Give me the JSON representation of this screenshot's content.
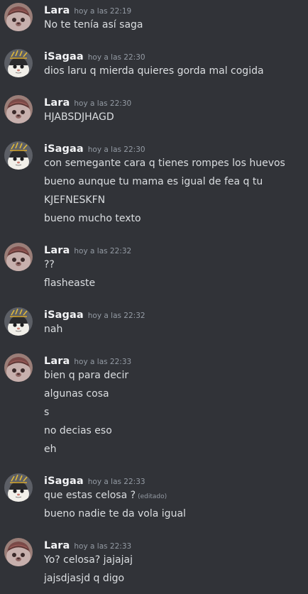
{
  "colors": {
    "background": "#313338",
    "username": "#f2f3f5",
    "timestamp": "#949ba4",
    "message_text": "#dbdee1"
  },
  "groups": [
    {
      "user": "Lara",
      "avatar": "lara-avatar",
      "time": "hoy a las 22:19",
      "messages": [
        {
          "text": "No te tenía así saga",
          "edited": ""
        }
      ]
    },
    {
      "user": "iSagaa",
      "avatar": "isagaa-avatar",
      "time": "hoy a las 22:30",
      "messages": [
        {
          "text": "dios laru q mierda quieres gorda mal cogida",
          "edited": ""
        }
      ]
    },
    {
      "user": "Lara",
      "avatar": "lara-avatar",
      "time": "hoy a las 22:30",
      "messages": [
        {
          "text": "HJABSDJHAGD",
          "edited": ""
        }
      ]
    },
    {
      "user": "iSagaa",
      "avatar": "isagaa-avatar",
      "time": "hoy a las 22:30",
      "messages": [
        {
          "text": "con semegante cara q tienes rompes los huevos",
          "edited": ""
        },
        {
          "text": "bueno aunque tu mama es igual de fea q tu",
          "edited": ""
        },
        {
          "text": "KJEFNESKFN",
          "edited": ""
        },
        {
          "text": "bueno mucho texto",
          "edited": ""
        }
      ]
    },
    {
      "user": "Lara",
      "avatar": "lara-avatar",
      "time": "hoy a las 22:32",
      "messages": [
        {
          "text": "??",
          "edited": ""
        },
        {
          "text": "flasheaste",
          "edited": ""
        }
      ]
    },
    {
      "user": "iSagaa",
      "avatar": "isagaa-avatar",
      "time": "hoy a las 22:32",
      "messages": [
        {
          "text": "nah",
          "edited": ""
        }
      ]
    },
    {
      "user": "Lara",
      "avatar": "lara-avatar",
      "time": "hoy a las 22:33",
      "messages": [
        {
          "text": "bien q para decir",
          "edited": ""
        },
        {
          "text": "algunas cosa",
          "edited": ""
        },
        {
          "text": "s",
          "edited": ""
        },
        {
          "text": "no decias eso",
          "edited": ""
        },
        {
          "text": "eh",
          "edited": ""
        }
      ]
    },
    {
      "user": "iSagaa",
      "avatar": "isagaa-avatar",
      "time": "hoy a las 22:33",
      "messages": [
        {
          "text": "que estas celosa ?",
          "edited": "(editado)"
        },
        {
          "text": "bueno nadie te da vola igual",
          "edited": ""
        }
      ]
    },
    {
      "user": "Lara",
      "avatar": "lara-avatar",
      "time": "hoy a las 22:33",
      "messages": [
        {
          "text": "Yo? celosa? jajajaj",
          "edited": ""
        },
        {
          "text": "jajsdjasjd q digo",
          "edited": ""
        }
      ]
    }
  ]
}
